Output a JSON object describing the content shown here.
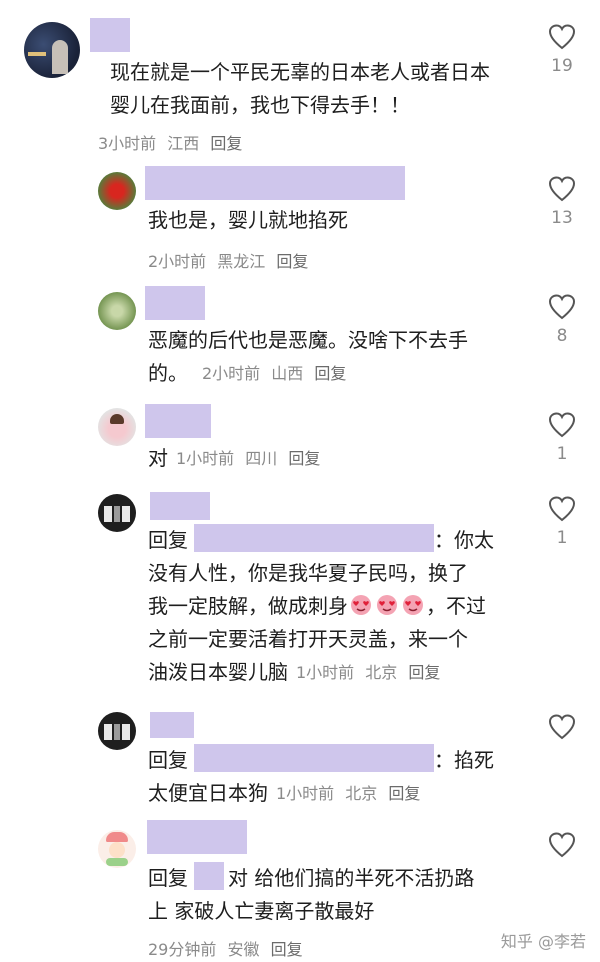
{
  "comments": [
    {
      "text_lines": [
        "现在就是一个平民无辜的日本老人或者日本",
        "婴儿在我面前，我也下得去手！！"
      ],
      "time": "3小时前",
      "location": "江西",
      "reply": "回复",
      "likes": "19"
    },
    {
      "text_lines": [
        "我也是，婴儿就地掐死"
      ],
      "time": "2小时前",
      "location": "黑龙江",
      "reply": "回复",
      "likes": "13"
    },
    {
      "text_lines": [
        "恶魔的后代也是恶魔。没啥下不去手",
        "的。"
      ],
      "time": "2小时前",
      "location": "山西",
      "reply": "回复",
      "likes": "8"
    },
    {
      "text_lines": [
        "对"
      ],
      "time": "1小时前",
      "location": "四川",
      "reply": "回复",
      "likes": "1"
    },
    {
      "reply_prefix": "回复",
      "after_mask": "：你太",
      "text_lines": [
        "没有人性，你是我华夏子民吗，换了",
        "我一定肢解，做成刺身",
        "，不过",
        "之前一定要活着打开天灵盖，来一个",
        "油泼日本婴儿脑"
      ],
      "time": "1小时前",
      "location": "北京",
      "reply": "回复",
      "likes": "1"
    },
    {
      "reply_prefix": "回复",
      "after_mask": "：掐死",
      "text_lines": [
        "太便宜日本狗"
      ],
      "time": "1小时前",
      "location": "北京",
      "reply": "回复"
    },
    {
      "reply_prefix": "回复",
      "after_mask": "对 给他们搞的半死不活扔路",
      "text_lines": [
        "上 家破人亡妻离子散最好"
      ],
      "time": "29分钟前",
      "location": "安徽",
      "reply": "回复"
    }
  ],
  "colors": {
    "mask": "#cfc6ec",
    "meta": "#8a8a8a"
  },
  "icons": {
    "like": "heart-outline-icon",
    "emoji": "heart-eyes-emoji-icon"
  },
  "watermark": "知乎 @李若"
}
